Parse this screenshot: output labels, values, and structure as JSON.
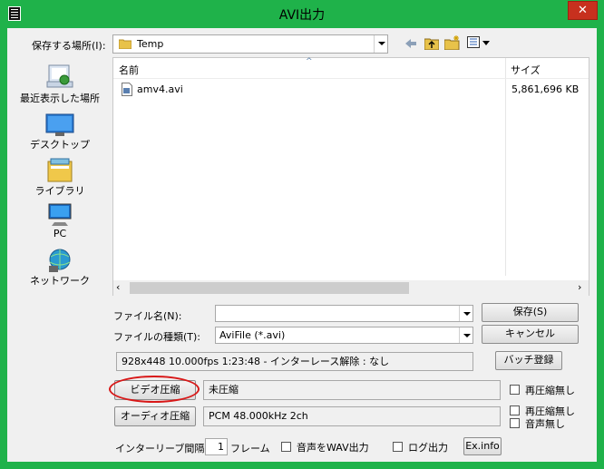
{
  "window": {
    "title": "AVI出力",
    "close_label": "✕"
  },
  "location": {
    "label": "保存する場所(I):",
    "folder": "Temp"
  },
  "places": [
    {
      "label": "最近表示した場所",
      "icon": "recent-places-icon"
    },
    {
      "label": "デスクトップ",
      "icon": "desktop-icon"
    },
    {
      "label": "ライブラリ",
      "icon": "libraries-icon"
    },
    {
      "label": "PC",
      "icon": "pc-icon"
    },
    {
      "label": "ネットワーク",
      "icon": "network-icon"
    }
  ],
  "file_list": {
    "columns": [
      "名前",
      "サイズ"
    ],
    "rows": [
      {
        "name": "amv4.avi",
        "size": "5,861,696 KB"
      }
    ]
  },
  "filename": {
    "label": "ファイル名(N):",
    "value": ""
  },
  "filetype": {
    "label": "ファイルの種類(T):",
    "value": "AviFile (*.avi)"
  },
  "buttons": {
    "save": "保存(S)",
    "cancel": "キャンセル",
    "batch": "バッチ登録",
    "video_compress": "ビデオ圧縮",
    "audio_compress": "オーディオ圧縮",
    "exinfo": "Ex.info"
  },
  "info_line": "928x448  10.000fps  1:23:48  -  インターレース解除 : なし",
  "video": {
    "codec": "未圧縮",
    "no_recompress": "再圧縮無し"
  },
  "audio": {
    "format": "PCM 48.000kHz 2ch",
    "no_recompress": "再圧縮無し",
    "no_audio": "音声無し"
  },
  "interleave": {
    "label": "インターリーブ間隔 :",
    "value": "1",
    "unit": "フレーム"
  },
  "options": {
    "wav_output": "音声をWAV出力",
    "log_output": "ログ出力"
  },
  "colors": {
    "frame": "#1fb24a",
    "close": "#c7301e",
    "highlight_circle": "#d81818"
  }
}
